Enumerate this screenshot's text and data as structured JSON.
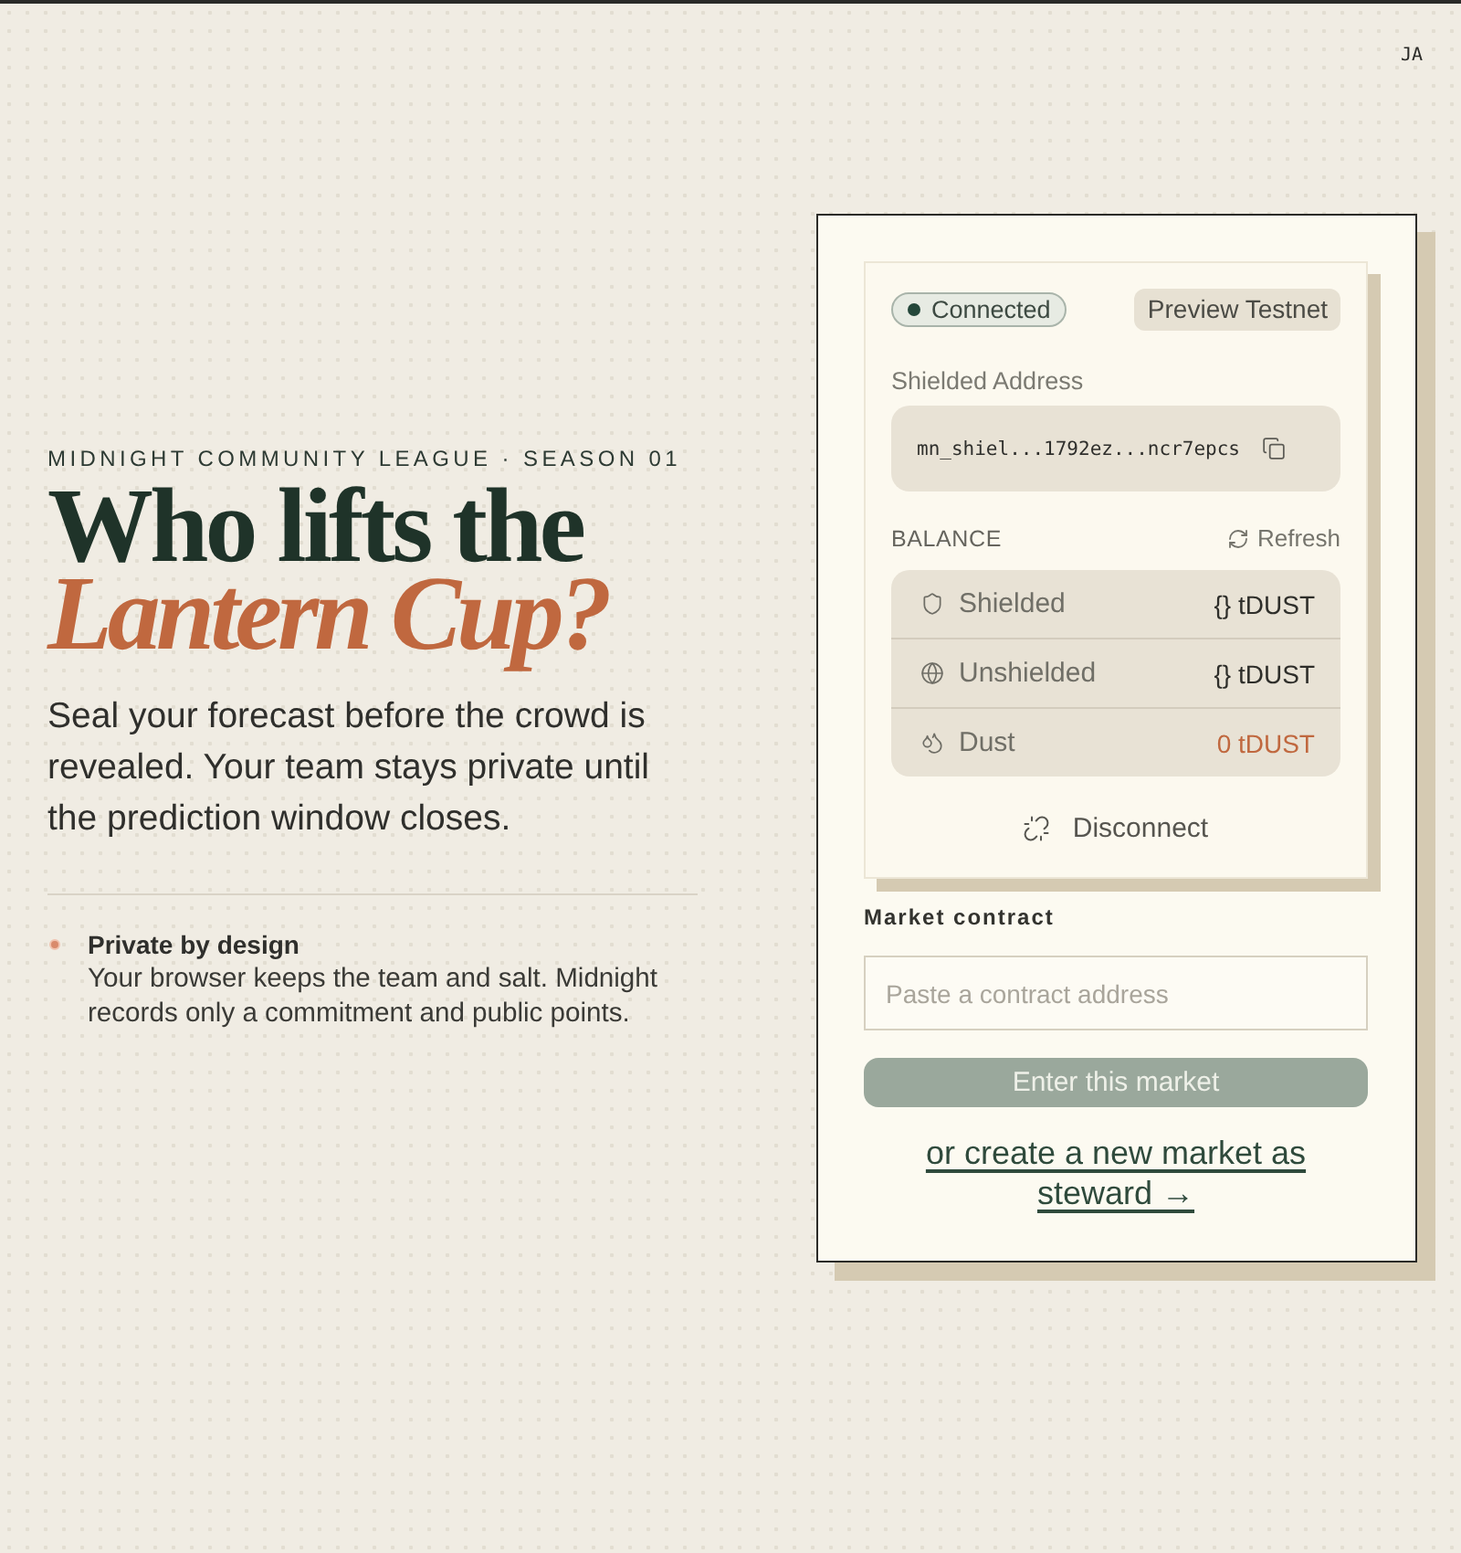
{
  "header": {
    "user_initials": "JA"
  },
  "intro": {
    "eyebrow": "MIDNIGHT COMMUNITY LEAGUE · SEASON 01",
    "headline": {
      "line_1": "Who lifts the",
      "line_2": "Lantern Cup?"
    },
    "lead": "Seal your forecast before the crowd is revealed. Your team stays private until the prediction window closes.",
    "features": [
      {
        "title": "Private by design",
        "description": "Your browser keeps the team and salt. Midnight records only a commitment and public points."
      }
    ]
  },
  "wallet": {
    "status": {
      "label": "Connected",
      "connected": true
    },
    "network": "Preview Testnet",
    "address_label": "Shielded Address",
    "address": "mn_shiel...1792ez...ncr7epcs",
    "balance_label": "BALANCE",
    "refresh_label": "Refresh",
    "balances": [
      {
        "kind": "shielded",
        "label": "Shielded",
        "value": "{} tDUST",
        "low": false
      },
      {
        "kind": "unshielded",
        "label": "Unshielded",
        "value": "{} tDUST",
        "low": false
      },
      {
        "kind": "dust",
        "label": "Dust",
        "value": "0 tDUST",
        "low": true
      }
    ],
    "disconnect_label": "Disconnect"
  },
  "market": {
    "label": "Market contract",
    "input": {
      "placeholder": "Paste a contract address"
    },
    "submit": {
      "label": "Enter this market",
      "disabled": true
    },
    "create_link": "or create a new market as steward →"
  }
}
